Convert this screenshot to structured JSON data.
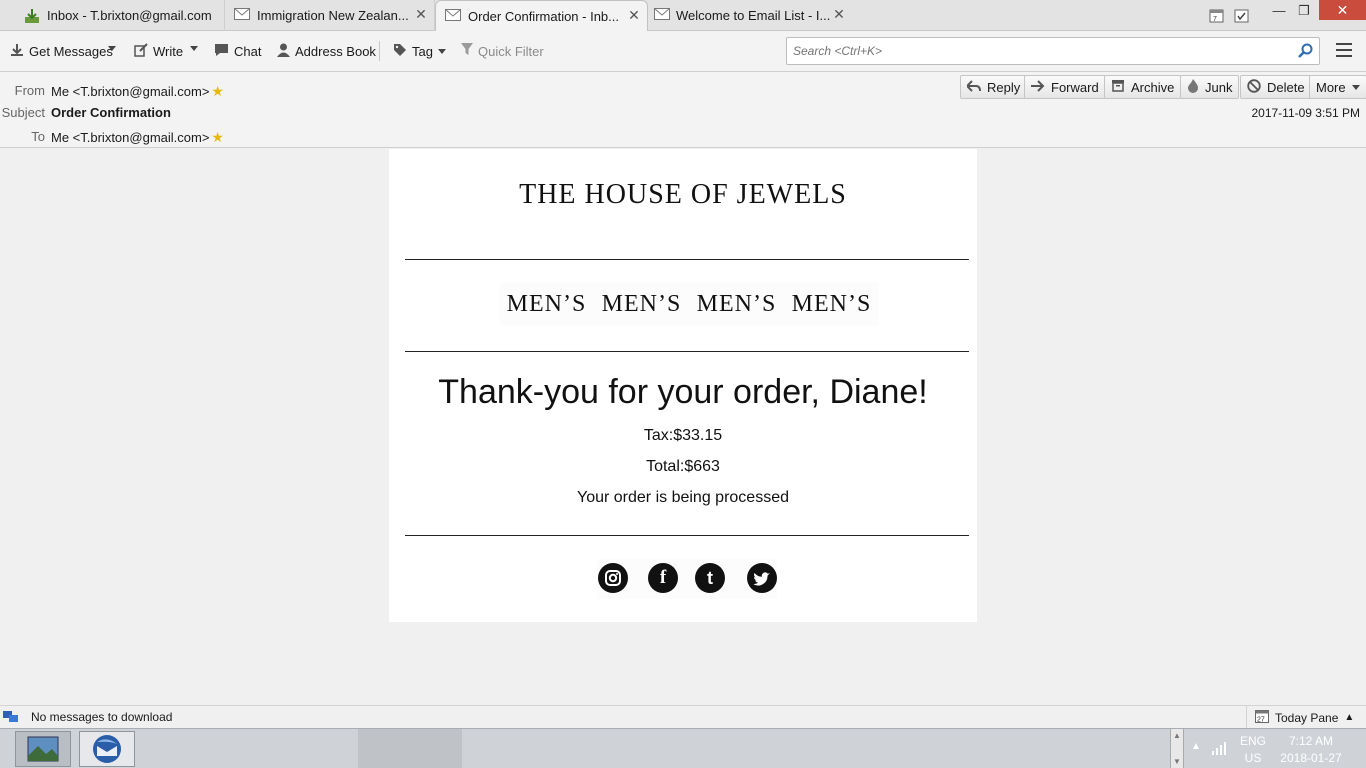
{
  "tabs": [
    {
      "label": "Inbox - T.brixton@gmail.com",
      "icon": "inbox-download-icon"
    },
    {
      "label": "Immigration New Zealan...",
      "icon": "envelope-icon"
    },
    {
      "label": "Order Confirmation - Inb...",
      "icon": "envelope-icon"
    },
    {
      "label": "Welcome to Email List - I...",
      "icon": "envelope-icon"
    }
  ],
  "toolbar": {
    "get_messages": "Get Messages",
    "write": "Write",
    "chat": "Chat",
    "address_book": "Address Book",
    "tag": "Tag",
    "quick_filter": "Quick Filter",
    "search_placeholder": "Search <Ctrl+K>"
  },
  "header": {
    "from_label": "From",
    "from_value": "Me <T.brixton@gmail.com>",
    "subject_label": "Subject",
    "subject_value": "Order Confirmation",
    "to_label": "To",
    "to_value": "Me <T.brixton@gmail.com>",
    "date": "2017-11-09 3:51 PM",
    "actions": {
      "reply": "Reply",
      "forward": "Forward",
      "archive": "Archive",
      "junk": "Junk",
      "delete": "Delete",
      "more": "More"
    }
  },
  "email": {
    "brand": "THE HOUSE OF JEWELS",
    "nav": [
      "MEN’S",
      "MEN’S",
      "MEN’S",
      "MEN’S"
    ],
    "thanks": "Thank-you for your order, Diane!",
    "tax": "Tax:$33.15",
    "total": "Total:$663",
    "status": "Your order is being processed",
    "socials": [
      "instagram-icon",
      "facebook-icon",
      "tumblr-icon",
      "twitter-icon"
    ]
  },
  "statusbar": {
    "text": "No messages to download",
    "today_pane": "Today Pane",
    "calendar_day": "27"
  },
  "taskbar": {
    "lang": "ENG",
    "region": "US",
    "time": "7:12 AM",
    "date": "2018-01-27"
  }
}
